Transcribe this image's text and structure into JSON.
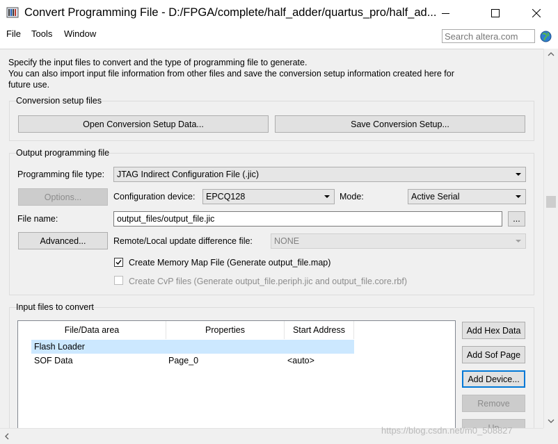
{
  "window": {
    "title": "Convert Programming File - D:/FPGA/complete/half_adder/quartus_pro/half_ad...",
    "icon": "quartus-app-icon"
  },
  "menu": {
    "items": [
      "File",
      "Tools",
      "Window"
    ]
  },
  "search": {
    "placeholder": "Search altera.com"
  },
  "intro": {
    "line1": "Specify the input files to convert and the type of programming file to generate.",
    "line2": "You can also import input file information from other files and save the conversion setup information created here for",
    "line3": "future use."
  },
  "conversion_setup": {
    "title": "Conversion setup files",
    "open_label": "Open Conversion Setup Data...",
    "save_label": "Save Conversion Setup..."
  },
  "output_file": {
    "title": "Output programming file",
    "type_label": "Programming file type:",
    "type_value": "JTAG Indirect Configuration File (.jic)",
    "options_label": "Options...",
    "device_label": "Configuration device:",
    "device_value": "EPCQ128",
    "mode_label": "Mode:",
    "mode_value": "Active Serial",
    "filename_label": "File name:",
    "filename_value": "output_files/output_file.jic",
    "browse_label": "...",
    "advanced_label": "Advanced...",
    "remote_label": "Remote/Local update difference file:",
    "remote_value": "NONE",
    "memmap_label": "Create Memory Map File (Generate output_file.map)",
    "memmap_checked": true,
    "cvp_label": "Create CvP files (Generate output_file.periph.jic and output_file.core.rbf)",
    "cvp_checked": false
  },
  "input_files": {
    "title": "Input files to convert",
    "columns": [
      "File/Data area",
      "Properties",
      "Start Address"
    ],
    "rows": [
      {
        "name": "Flash Loader",
        "properties": "",
        "address": "",
        "selected": true
      },
      {
        "name": "SOF Data",
        "properties": "Page_0",
        "address": "<auto>",
        "selected": false
      }
    ],
    "buttons": {
      "add_hex": "Add Hex Data",
      "add_sof": "Add Sof Page",
      "add_device": "Add Device...",
      "remove": "Remove",
      "up": "Up"
    }
  },
  "watermark": "https://blog.csdn.net/m0_508827",
  "colors": {
    "selection": "#cce8ff",
    "focus": "#0078d7",
    "panel": "#f0f0f0"
  }
}
